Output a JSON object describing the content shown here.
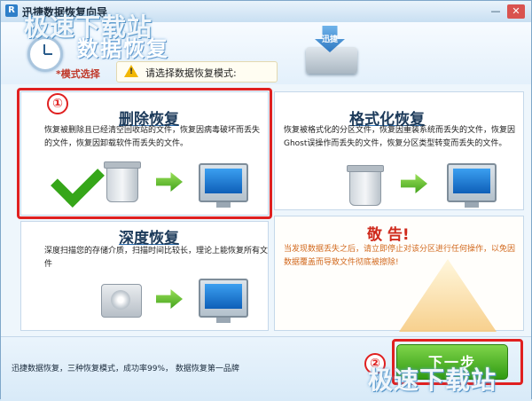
{
  "window": {
    "title": "迅捷数据恢复向导",
    "app_icon_letter": "R",
    "minimize_glyph": "—",
    "close_glyph": "✕"
  },
  "watermark": "极速下载站",
  "header": {
    "title": "数据恢复",
    "mode_label": "*模式选择",
    "mode_prompt": "请选择数据恢复模式:",
    "drive_tag": "迅捷"
  },
  "modes": [
    {
      "title": "删除恢复",
      "description": "恢复被删除且已经清空回收站的文件，恢复因病毒破坏而丢失的文件，恢复因卸载软件而丢失的文件。",
      "step_marker": "①"
    },
    {
      "title": "格式化恢复",
      "description": "恢复被格式化的分区文件，恢复因重装系统而丢失的文件，恢复因Ghost误操作而丢失的文件，恢复分区类型转变而丢失的文件。"
    },
    {
      "title": "深度恢复",
      "description": "深度扫描您的存储介质，扫描时间比较长，理论上能恢复所有文件"
    }
  ],
  "warning": {
    "title": "敬 告!",
    "text": "当发现数据丢失之后，请立即停止对该分区进行任何操作，以免因数据覆盖而导致文件彻底被擦除!"
  },
  "footer": {
    "slogan": "迅捷数据恢复，三种恢复模式，成功率99%，  数据恢复第一品牌",
    "next_label": "下一步",
    "step_marker": "②"
  },
  "colors": {
    "highlight": "#e02020",
    "accent": "#2e7fc9",
    "next_green": "#3aa317"
  }
}
